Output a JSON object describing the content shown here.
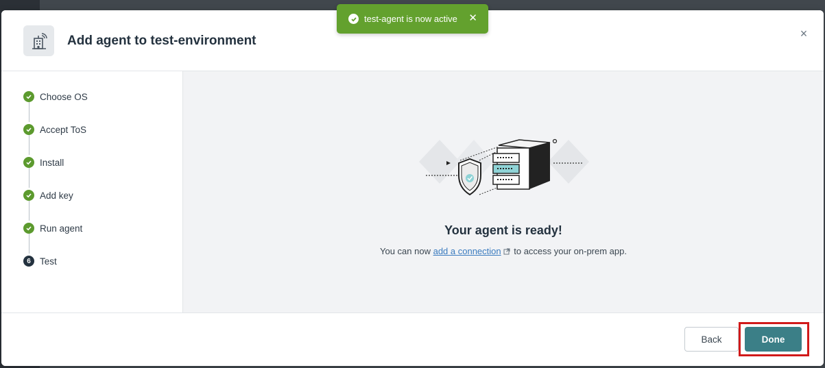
{
  "toast": {
    "message": "test-agent is now active",
    "close_glyph": "✕",
    "icon": "check-circle-icon",
    "color": "#63a12e"
  },
  "modal": {
    "title": "Add agent to test-environment",
    "header_icon": "building-signal-icon",
    "close_glyph": "×"
  },
  "steps": [
    {
      "label": "Choose OS",
      "state": "complete"
    },
    {
      "label": "Accept ToS",
      "state": "complete"
    },
    {
      "label": "Install",
      "state": "complete"
    },
    {
      "label": "Add key",
      "state": "complete"
    },
    {
      "label": "Run agent",
      "state": "complete"
    },
    {
      "label": "Test",
      "state": "current",
      "number": "6"
    }
  ],
  "main": {
    "title": "Your agent is ready!",
    "text_before": "You can now ",
    "link_text": "add a connection",
    "text_after": " to access your on-prem app."
  },
  "footer": {
    "back_label": "Back",
    "done_label": "Done"
  },
  "colors": {
    "accent": "#3b7f87",
    "success": "#5c9a2e",
    "highlight": "#d11a1a"
  }
}
